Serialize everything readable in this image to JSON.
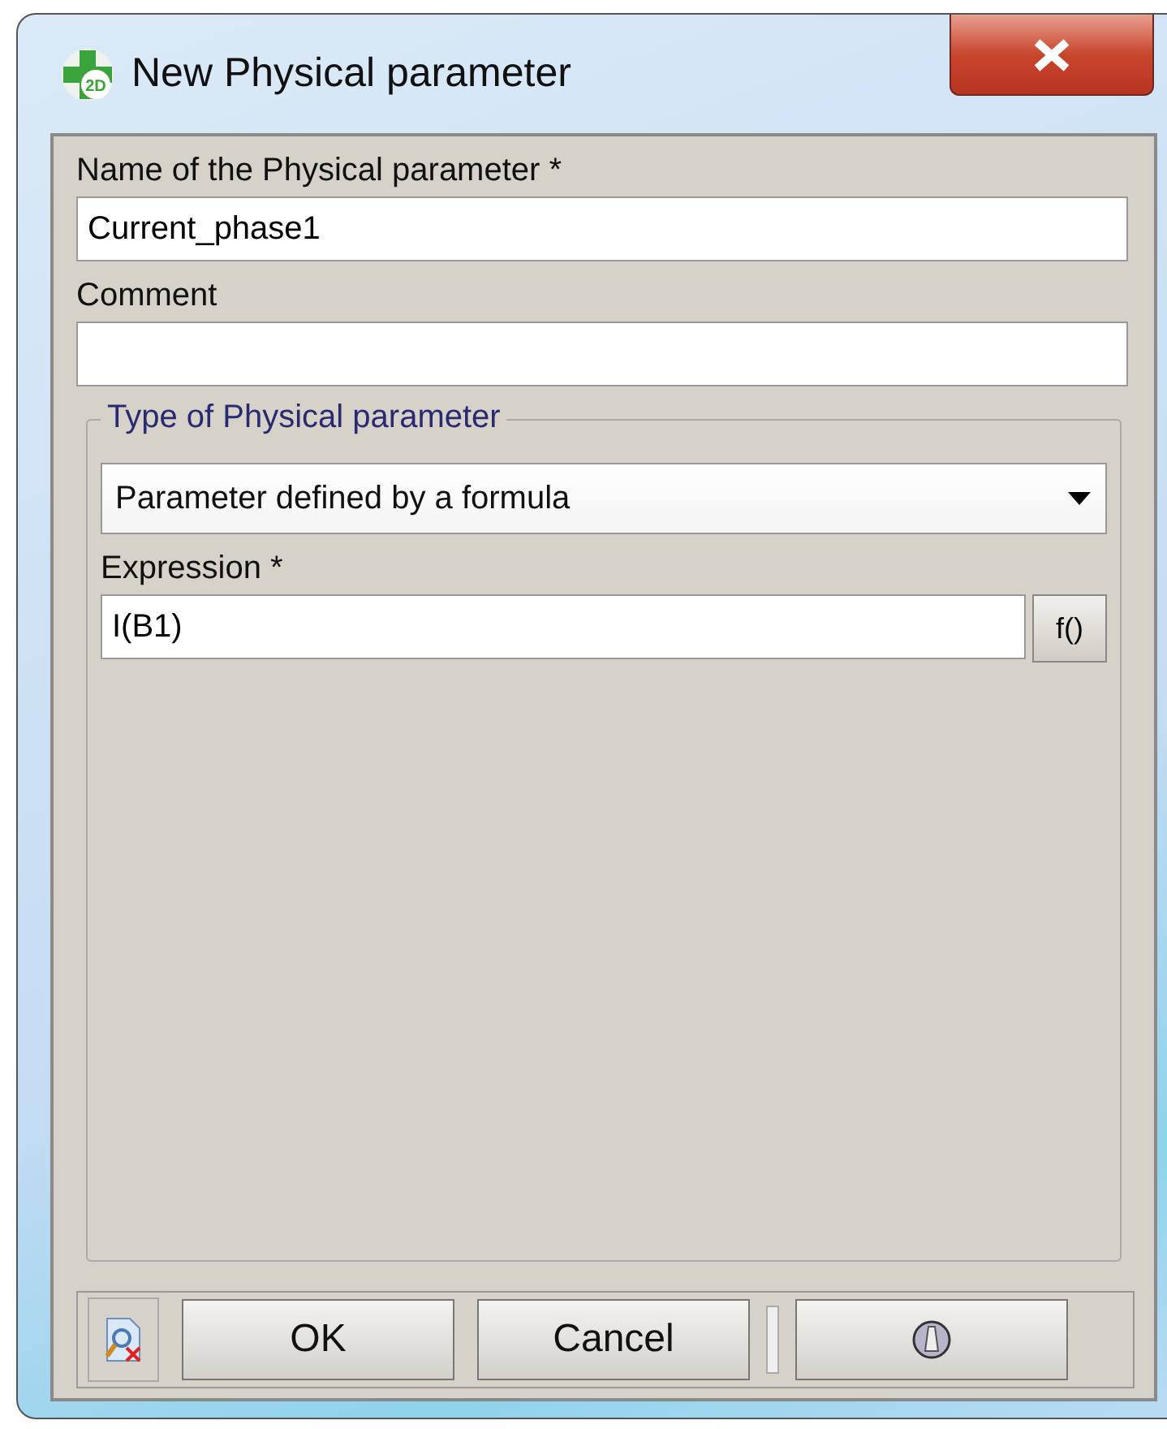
{
  "window": {
    "title": "New Physical parameter",
    "logo_text": "2D"
  },
  "name_field": {
    "label": "Name of the Physical parameter *",
    "value": "Current_phase1"
  },
  "comment_field": {
    "label": "Comment"
  },
  "type_group": {
    "title": "Type of Physical parameter",
    "selection": "Parameter defined by a formula",
    "expression": {
      "label": "Expression *",
      "value": "I(B1)",
      "function_button": "f()"
    }
  },
  "buttons": [
    {
      "label": "OK"
    },
    {
      "label": "Cancel"
    }
  ]
}
